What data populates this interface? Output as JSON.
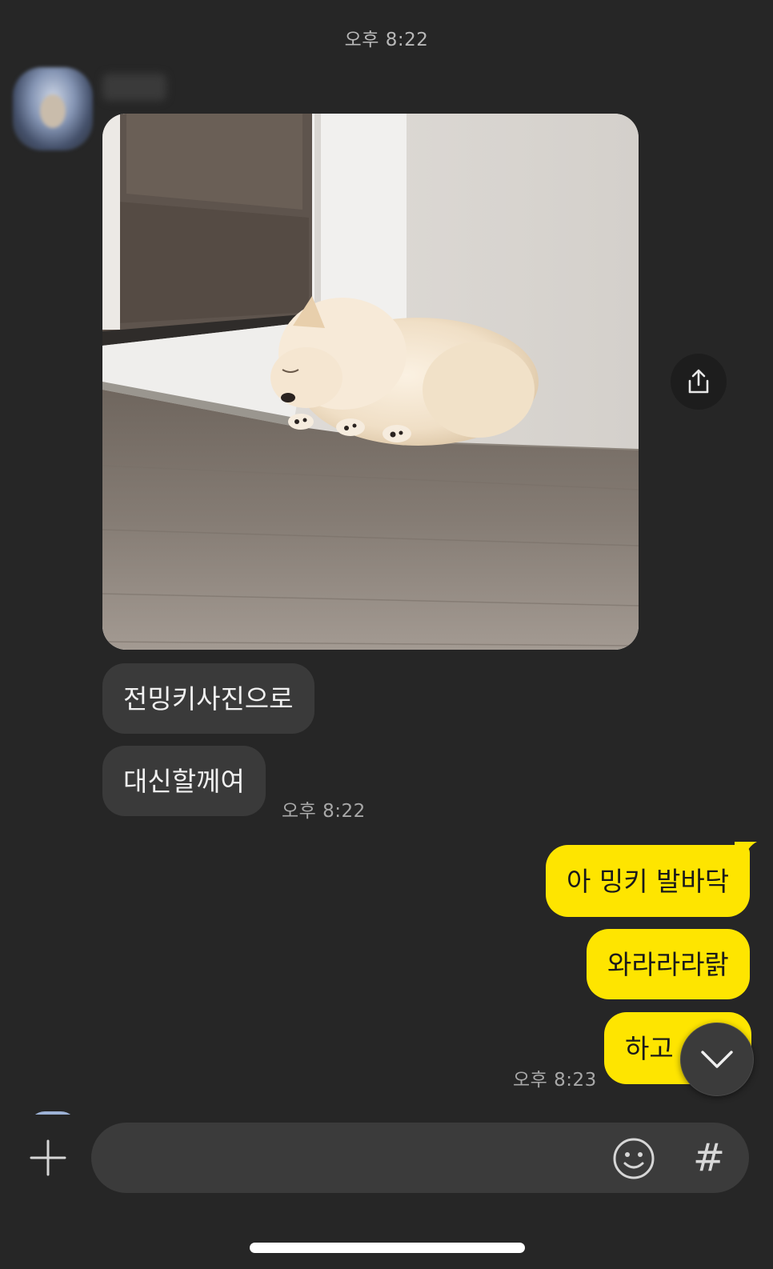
{
  "chat": {
    "date_time": "오후 8:22",
    "incoming": {
      "messages": [
        "전밍키사진으로",
        "대신할께여"
      ],
      "time": "오후 8:22"
    },
    "outgoing": {
      "messages": [
        "아 밍키 발바닥",
        "와라라라랅",
        "하고 싶다"
      ],
      "time": "오후 8:23"
    }
  },
  "input_bar": {
    "placeholder": "",
    "hash_label": "#"
  },
  "icons": {
    "share": "share-icon",
    "scroll_down": "chevron-down-icon",
    "attach": "plus-icon",
    "emoji": "emoji-icon"
  },
  "colors": {
    "background": "#262626",
    "incoming_bubble": "#3a3a3a",
    "outgoing_bubble": "#fee500",
    "input_field": "#3b3b3b"
  }
}
